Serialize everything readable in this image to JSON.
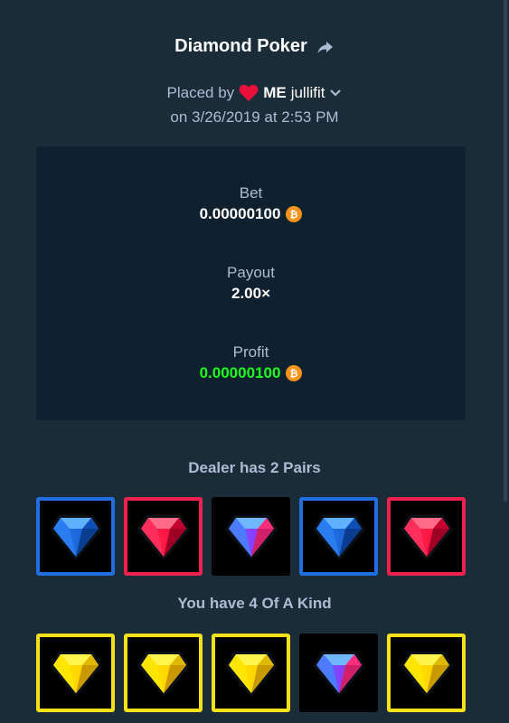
{
  "header": {
    "title": "Diamond Poker",
    "placed_by_label": "Placed by",
    "user_badge": "ME",
    "username": "jullifit",
    "date_line": "on 3/26/2019 at 2:53 PM"
  },
  "stats": {
    "bet_label": "Bet",
    "bet_value": "0.00000100",
    "payout_label": "Payout",
    "payout_value": "2.00×",
    "profit_label": "Profit",
    "profit_value": "0.00000100"
  },
  "dealer": {
    "result_text": "Dealer has 2 Pairs",
    "cards": [
      {
        "gem": "blue-diamond-icon",
        "highlight": "blue"
      },
      {
        "gem": "red-diamond-icon",
        "highlight": "red"
      },
      {
        "gem": "purple-diamond-icon",
        "highlight": "none"
      },
      {
        "gem": "blue-diamond-icon",
        "highlight": "blue"
      },
      {
        "gem": "red-diamond-icon",
        "highlight": "red"
      }
    ]
  },
  "player": {
    "result_text": "You have 4 Of A Kind",
    "cards": [
      {
        "gem": "yellow-diamond-icon",
        "highlight": "yellow"
      },
      {
        "gem": "yellow-diamond-icon",
        "highlight": "yellow"
      },
      {
        "gem": "yellow-diamond-icon",
        "highlight": "yellow"
      },
      {
        "gem": "purple-diamond-icon",
        "highlight": "none"
      },
      {
        "gem": "yellow-diamond-icon",
        "highlight": "yellow"
      }
    ]
  },
  "colors": {
    "background": "#1a2c38",
    "panel": "#0f212e",
    "profit_green": "#1fff20",
    "blue_highlight": "#1f6fe0",
    "red_highlight": "#f0204f",
    "yellow_highlight": "#f5e117"
  }
}
